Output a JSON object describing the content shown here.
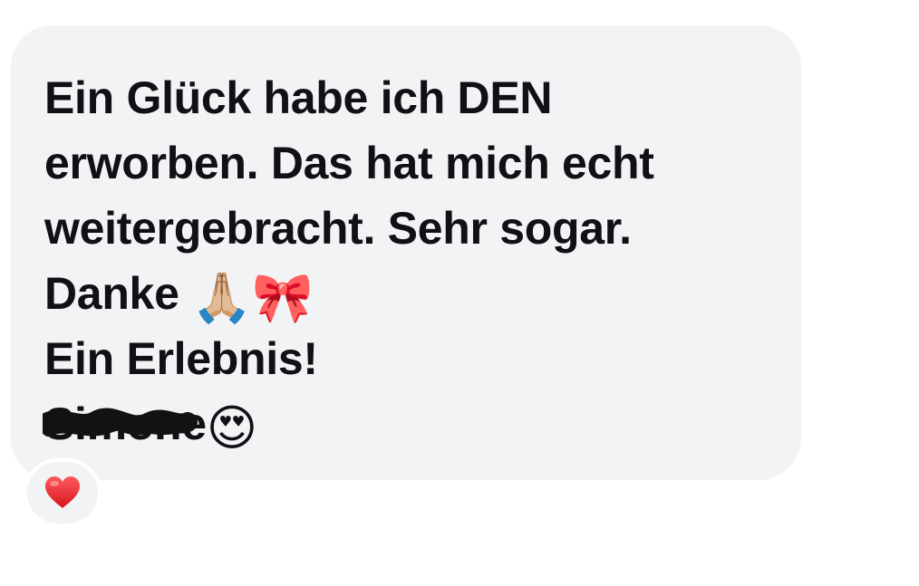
{
  "message": {
    "lines": [
      "Ein Glück habe ich DEN",
      "erworben. Das hat mich echt",
      "weitergebracht. Sehr sogar.",
      "Danke",
      "Ein Erlebnis!",
      "Simone"
    ],
    "emoji": {
      "folded_hands": "🙏🏼",
      "ribbon": "🎀",
      "heart_eyes": "😍"
    },
    "signature_redacted": true
  },
  "reaction": {
    "emoji": "❤️",
    "icon": "heart-icon",
    "color": "#e3232b"
  },
  "colors": {
    "bubble_background": "#f2f3f5",
    "text": "#101114",
    "page_background": "#ffffff"
  }
}
